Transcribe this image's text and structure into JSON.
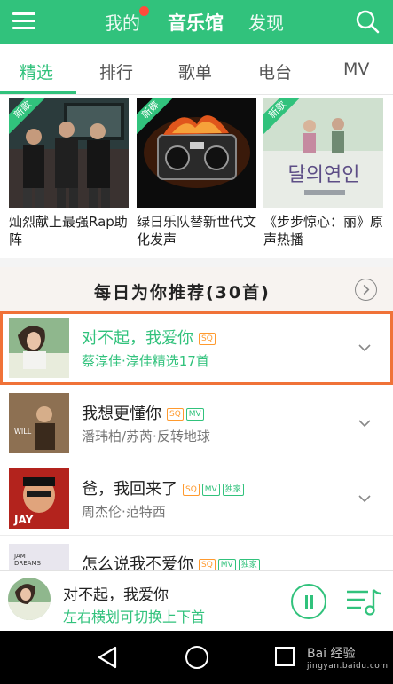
{
  "topbar": {
    "tabs": [
      "我的",
      "音乐馆",
      "发现"
    ]
  },
  "tabs": [
    "精选",
    "排行",
    "歌单",
    "电台",
    "MV"
  ],
  "banners": [
    {
      "badge": "新歌",
      "caption": "灿烈献上最强Rap助阵"
    },
    {
      "badge": "新碟",
      "caption": "绿日乐队替新世代文化发声"
    },
    {
      "badge": "新歌",
      "caption": "《步步惊心：丽》原声热播"
    }
  ],
  "daily": {
    "title": "每日为你推荐(30首)"
  },
  "songs": [
    {
      "name": "对不起，我爱你",
      "tags": [
        "SQ"
      ],
      "artist": "蔡淳佳·淳佳精选17首",
      "playing": true
    },
    {
      "name": "我想更懂你",
      "tags": [
        "SQ",
        "MV"
      ],
      "artist": "潘玮柏/苏芮·反转地球",
      "playing": false
    },
    {
      "name": "爸，我回来了",
      "tags": [
        "SQ",
        "MV",
        "独家"
      ],
      "artist": "周杰伦·范特西",
      "playing": false
    },
    {
      "name": "怎么说我不爱你",
      "tags": [
        "SQ",
        "MV",
        "独家"
      ],
      "artist": "",
      "playing": false
    }
  ],
  "player": {
    "title": "对不起，我爱你",
    "hint": "左右横划可切换上下首"
  },
  "watermark": {
    "brand": "Bai 经验",
    "url": "jingyan.baidu.com"
  },
  "colors": {
    "accent": "#31c27c",
    "highlight_border": "#f07238",
    "sq_tag": "#ff9a2e"
  }
}
